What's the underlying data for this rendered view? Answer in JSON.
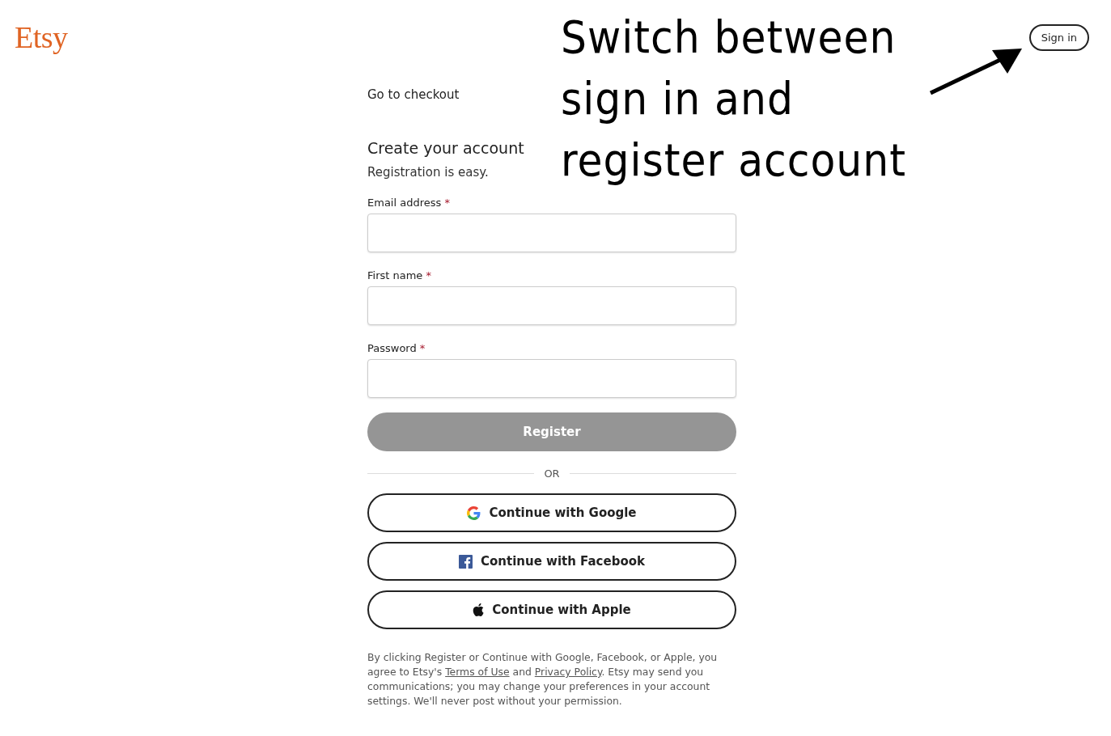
{
  "header": {
    "logo": "Etsy",
    "sign_in": "Sign in"
  },
  "form": {
    "top_link": "Go to checkout",
    "title": "Create your account",
    "subtitle": "Registration is easy.",
    "fields": [
      {
        "label": "Email address",
        "required": "*"
      },
      {
        "label": "First name",
        "required": "*"
      },
      {
        "label": "Password",
        "required": "*"
      }
    ],
    "register": {
      "label": "Register",
      "disabled": true
    },
    "divider": "OR",
    "social": [
      {
        "kind": "google",
        "label": "Continue with Google"
      },
      {
        "kind": "facebook",
        "label": "Continue with Facebook"
      },
      {
        "kind": "apple",
        "label": "Continue with Apple"
      }
    ],
    "legal": [
      {
        "kind": "text",
        "text": "By clicking Register or Continue with Google, Facebook, or Apple, you agree to Etsy's "
      },
      {
        "kind": "link",
        "text": "Terms of Use"
      },
      {
        "kind": "text",
        "text": " and "
      },
      {
        "kind": "link",
        "text": "Privacy Policy"
      },
      {
        "kind": "text",
        "text": ". Etsy may send you communications; you may change your preferences in your account settings. We'll never post without your permission."
      }
    ]
  },
  "annotation": {
    "lines": [
      "Switch between",
      "sign in and",
      "register account"
    ]
  }
}
